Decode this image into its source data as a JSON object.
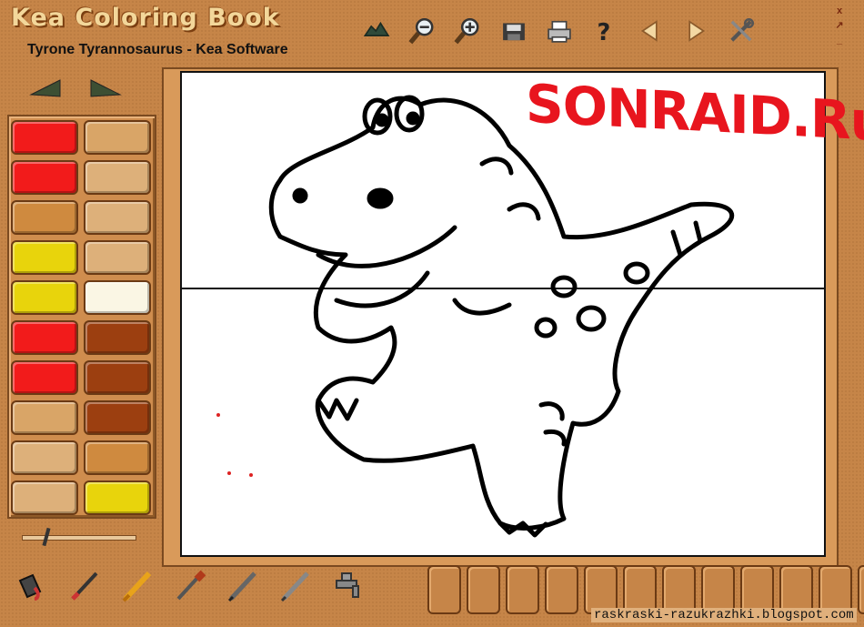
{
  "app": {
    "logo": "Kea Coloring Book",
    "document_title": "Tyrone Tyrannosaurus - Kea Software"
  },
  "toolbar": {
    "buttons": [
      {
        "name": "stamp-icon"
      },
      {
        "name": "zoom-out-icon"
      },
      {
        "name": "zoom-in-icon"
      },
      {
        "name": "save-icon"
      },
      {
        "name": "print-icon"
      },
      {
        "name": "help-icon"
      },
      {
        "name": "previous-icon"
      },
      {
        "name": "next-icon"
      },
      {
        "name": "settings-icon"
      }
    ]
  },
  "window_buttons": {
    "close": "x",
    "restore": "↗",
    "minimize": "_"
  },
  "palette": {
    "colors_left": [
      "#f21b1b",
      "#f21b1b",
      "#cf8a3f",
      "#e8d40c",
      "#e8d40c",
      "#f21b1b",
      "#f21b1b",
      "#d9a567",
      "#ddb07a",
      "#ddb07a"
    ],
    "colors_right": [
      "#d9a567",
      "#ddb07a",
      "#ddb07a",
      "#ddb07a",
      "#faf6e4",
      "#9c3f10",
      "#9c3f10",
      "#9c3f10",
      "#cf8a3f",
      "#e8d40c"
    ]
  },
  "brush_size": {
    "value": 0.2
  },
  "canvas": {
    "watermark": "SONRAID.Ru"
  },
  "bottom_tools": [
    {
      "name": "paint-bucket-icon"
    },
    {
      "name": "brush-icon"
    },
    {
      "name": "crayon-icon"
    },
    {
      "name": "dropper-icon"
    },
    {
      "name": "pencil-icon"
    },
    {
      "name": "marker-icon"
    },
    {
      "name": "faucet-icon"
    }
  ],
  "stamp_slots_count": 12,
  "footer": {
    "site": "raskraski-razukrazhki.blogspot.com"
  }
}
